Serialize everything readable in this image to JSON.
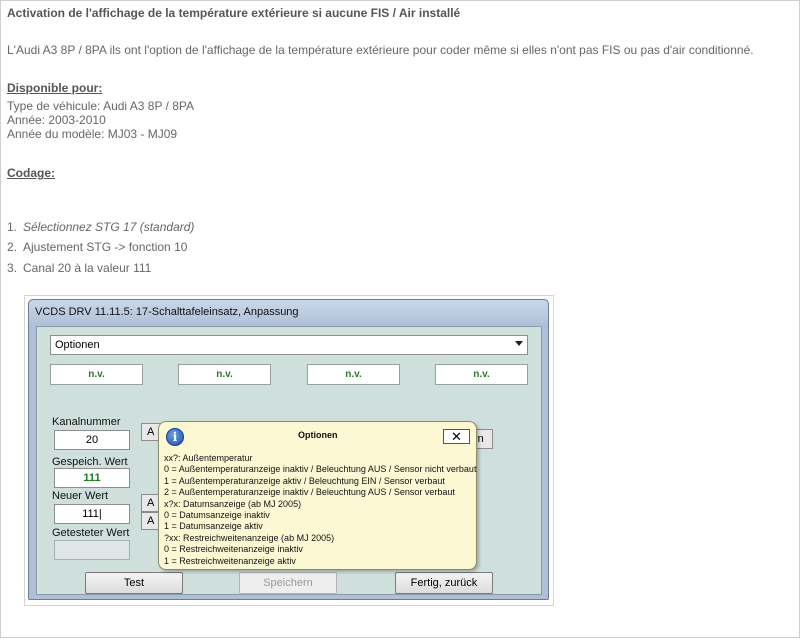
{
  "article": {
    "title": "Activation de l'affichage de la température extérieure si aucune FIS / Air installé",
    "intro": "L'Audi A3 8P / 8PA ils ont l'option de l'affichage de la température extérieure pour coder même si elles n'ont pas FIS ou pas d'air conditionné.",
    "available_heading": "Disponible pour:",
    "available_lines": [
      "Type de véhicule: Audi A3 8P / 8PA",
      "Année: 2003-2010",
      "Année du modèle: MJ03 - MJ09"
    ],
    "coding_heading": "Codage:",
    "steps": [
      {
        "num": "1.",
        "text": "Sélectionnez STG 17 (standard)"
      },
      {
        "num": "2.",
        "text": "Ajustement STG -> fonction 10"
      },
      {
        "num": "3.",
        "text": "Canal 20 à la valeur 111"
      }
    ]
  },
  "window": {
    "title": "VCDS DRV 11.11.5: 17-Schalttafeleinsatz,  Anpassung",
    "dropdown_value": "Optionen",
    "nv_boxes": [
      "n.v.",
      "n.v.",
      "n.v.",
      "n.v."
    ],
    "kanal_label": "Kanalnummer",
    "kanal_value": "20",
    "gespeich_label": "Gespeich. Wert",
    "gespeich_value": "111",
    "neuer_label": "Neuer Wert",
    "neuer_value": "111|",
    "getestet_label": "Getesteter Wert",
    "getestet_value": "",
    "small_btn_a1": "A",
    "small_btn_a2": "A",
    "small_btn_a3": "A",
    "partial_btn": "rn",
    "btn_test": "Test",
    "btn_speichern": "Speichern",
    "btn_fertig": "Fertig, zurück"
  },
  "popup": {
    "title": "Optionen",
    "close": "✕",
    "lines": [
      "xx?: Außentemperatur",
      "0 = Außentemperaturanzeige inaktiv / Beleuchtung AUS / Sensor nicht verbaut",
      "1 = Außentemperaturanzeige aktiv / Beleuchtung EIN / Sensor verbaut",
      "2 = Außentemperaturanzeige inaktiv / Beleuchtung AUS / Sensor verbaut",
      "x?x: Datumsanzeige (ab MJ 2005)",
      "0 = Datumsanzeige inaktiv",
      "1 = Datumsanzeige aktiv",
      "?xx: Restreichweitenanzeige (ab MJ 2005)",
      "0 = Restreichweitenanzeige inaktiv",
      "1 = Restreichweitenanzeige aktiv"
    ]
  },
  "colors": {
    "nv_text": "#2a7a2a",
    "window_frame": "#aebfd6",
    "client_bg": "#cfdfdc",
    "popup_bg": "#fdf8d4"
  },
  "icons": {
    "info": "info-icon",
    "dropdown": "chevron-down-icon",
    "close": "close-icon"
  }
}
